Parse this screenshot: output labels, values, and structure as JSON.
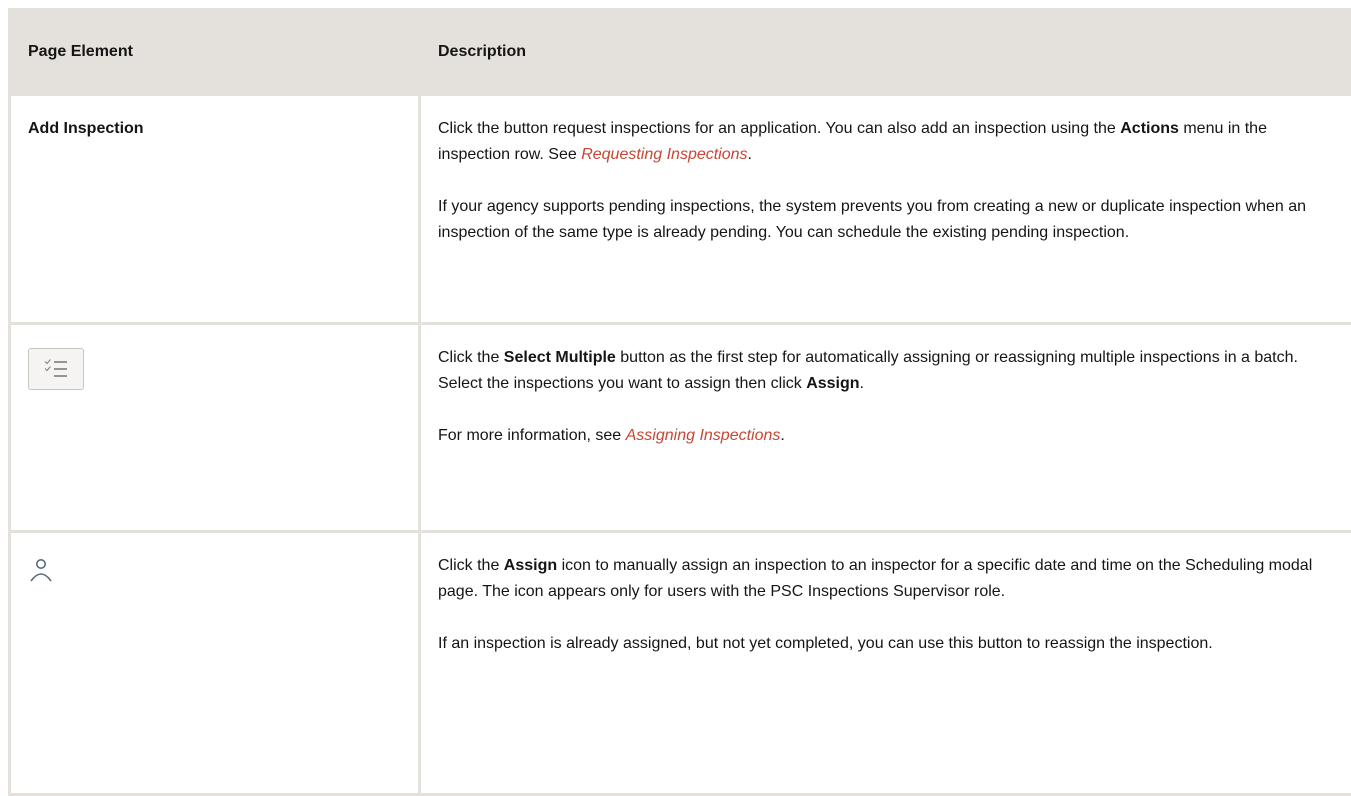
{
  "table": {
    "headers": [
      "Page Element",
      "Description"
    ],
    "rows": [
      {
        "element": "Add Inspection",
        "p1_a": "Click the button request inspections for an application. You can also add an inspection using the ",
        "p1_b": "Actions",
        "p1_c": " menu in the inspection row. See ",
        "p1_link": "Requesting Inspections",
        "p1_d": ".",
        "p2": "If your agency supports pending inspections, the system prevents you from creating a new or duplicate inspection when an inspection of the same type is already pending. You can schedule the existing pending inspection."
      },
      {
        "element_icon": "select-multiple-icon",
        "p1_a": "Click the ",
        "p1_b": "Select Multiple",
        "p1_c": " button as the first step for automatically assigning or reassigning multiple inspections in a batch. Select the inspections you want to assign then click ",
        "p1_d": "Assign",
        "p1_e": ".",
        "p2_a": "For more information, see ",
        "p2_link": "Assigning Inspections",
        "p2_b": "."
      },
      {
        "element_icon": "assign-person-icon",
        "p1_a": "Click the ",
        "p1_b": "Assign",
        "p1_c": " icon to manually assign an inspection to an inspector for a specific date and time on the Scheduling modal page. The icon appears only for users with the PSC Inspections Supervisor role.",
        "p2": "If an inspection is already assigned, but not yet completed, you can use this button to reassign the inspection."
      }
    ]
  },
  "colors": {
    "header_bg": "#e4e1dd",
    "border": "#e4e1dd",
    "link": "#c74634",
    "text": "#161513"
  }
}
